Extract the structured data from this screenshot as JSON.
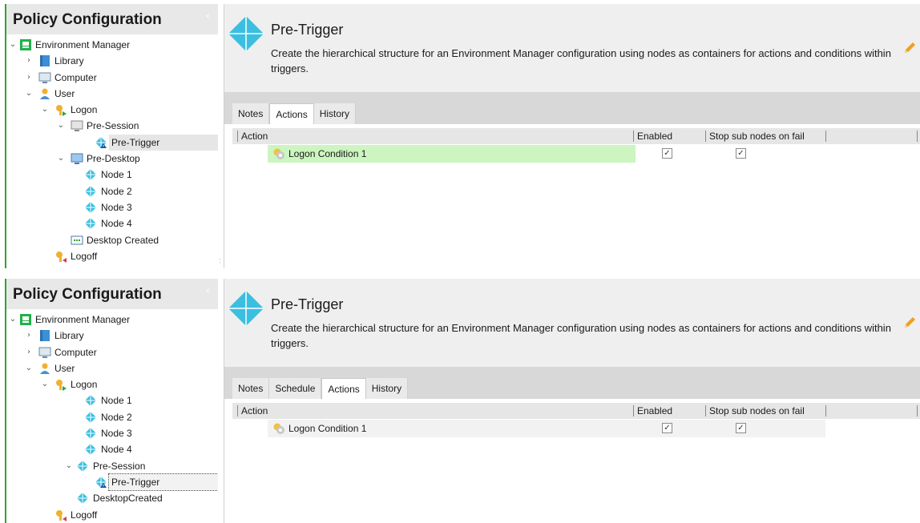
{
  "colors": {
    "accent_green": "#2ea42e",
    "selected_row_fill": "#ccf5c0",
    "plain_row_fill": "#f2f2f2",
    "diamond": "#3bbfe0"
  },
  "panels": [
    {
      "left_title": "Policy Configuration",
      "collapse_glyph": "‹",
      "tree": [
        {
          "label": "Environment Manager",
          "icon": "environment-manager-icon",
          "expander": "⌄"
        },
        {
          "label": "Library",
          "icon": "library-book-icon",
          "expander": "›"
        },
        {
          "label": "Computer",
          "icon": "computer-monitor-icon",
          "expander": "›"
        },
        {
          "label": "User",
          "icon": "user-icon",
          "expander": "⌄"
        },
        {
          "label": "Logon",
          "icon": "logon-key-icon",
          "expander": "⌄"
        },
        {
          "label": "Pre-Session",
          "icon": "session-monitor-icon",
          "expander": "⌄"
        },
        {
          "label": "Pre-Trigger",
          "icon": "trigger-node-warning-icon",
          "expander": ""
        },
        {
          "label": "Pre-Desktop",
          "icon": "desktop-monitor-icon",
          "expander": "⌄"
        },
        {
          "label": "Node 1",
          "icon": "node-diamond-icon",
          "expander": ""
        },
        {
          "label": "Node 2",
          "icon": "node-diamond-icon",
          "expander": ""
        },
        {
          "label": "Node 3",
          "icon": "node-diamond-icon",
          "expander": ""
        },
        {
          "label": "Node 4",
          "icon": "node-diamond-icon",
          "expander": ""
        },
        {
          "label": "Desktop Created",
          "icon": "desktop-created-icon",
          "expander": ""
        },
        {
          "label": "Logoff",
          "icon": "logoff-key-icon",
          "expander": ""
        }
      ],
      "title": "Pre-Trigger",
      "description": "Create the hierarchical structure for an Environment Manager configuration using nodes as containers for actions and conditions within triggers.",
      "tabs": [
        {
          "label": "Notes",
          "active": false
        },
        {
          "label": "Actions",
          "active": true
        },
        {
          "label": "History",
          "active": false
        }
      ],
      "columns": [
        "Action",
        "Enabled",
        "Stop sub nodes on fail",
        ""
      ],
      "rows": [
        {
          "label": "Logon Condition 1",
          "enabled": "✓",
          "stop_sub_nodes": "✓"
        }
      ]
    },
    {
      "left_title": "Policy Configuration",
      "collapse_glyph": "‹",
      "tree": [
        {
          "label": "Environment Manager",
          "icon": "environment-manager-icon",
          "expander": "⌄"
        },
        {
          "label": "Library",
          "icon": "library-book-icon",
          "expander": "›"
        },
        {
          "label": "Computer",
          "icon": "computer-monitor-icon",
          "expander": "›"
        },
        {
          "label": "User",
          "icon": "user-icon",
          "expander": "⌄"
        },
        {
          "label": "Logon",
          "icon": "logon-key-icon",
          "expander": "⌄"
        },
        {
          "label": "Node 1",
          "icon": "node-diamond-icon",
          "expander": ""
        },
        {
          "label": "Node 2",
          "icon": "node-diamond-icon",
          "expander": ""
        },
        {
          "label": "Node 3",
          "icon": "node-diamond-icon",
          "expander": ""
        },
        {
          "label": "Node 4",
          "icon": "node-diamond-icon",
          "expander": ""
        },
        {
          "label": "Pre-Session",
          "icon": "node-diamond-icon",
          "expander": "⌄"
        },
        {
          "label": "Pre-Trigger",
          "icon": "trigger-node-warning-icon",
          "expander": ""
        },
        {
          "label": "DesktopCreated",
          "icon": "node-diamond-icon",
          "expander": ""
        },
        {
          "label": "Logoff",
          "icon": "logoff-key-icon",
          "expander": ""
        }
      ],
      "title": "Pre-Trigger",
      "description": "Create the hierarchical structure for an Environment Manager configuration using nodes as containers for actions and conditions within triggers.",
      "tabs": [
        {
          "label": "Notes",
          "active": false
        },
        {
          "label": "Schedule",
          "active": false
        },
        {
          "label": "Actions",
          "active": true
        },
        {
          "label": "History",
          "active": false
        }
      ],
      "columns": [
        "Action",
        "Enabled",
        "Stop sub nodes on fail",
        ""
      ],
      "rows": [
        {
          "label": "Logon Condition 1",
          "enabled": "✓",
          "stop_sub_nodes": "✓"
        }
      ]
    }
  ]
}
